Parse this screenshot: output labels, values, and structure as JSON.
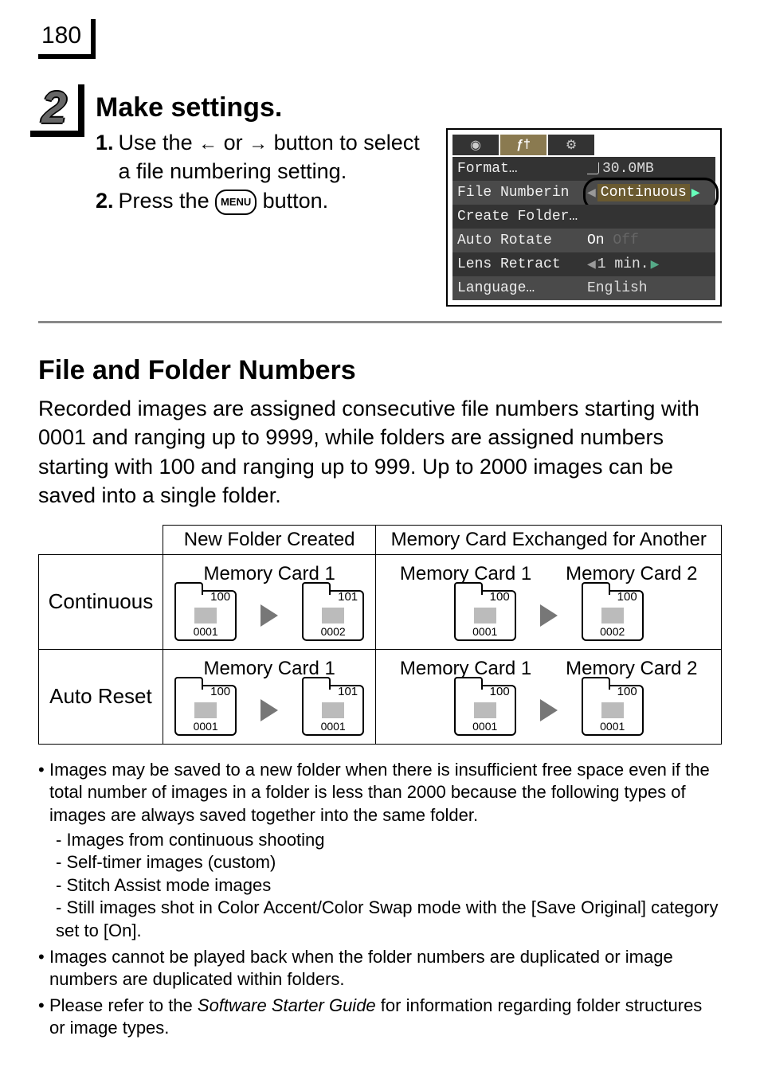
{
  "page_number": "180",
  "step": {
    "number": "2",
    "title": "Make settings.",
    "sub1_num": "1.",
    "sub1_a": "Use the ",
    "sub1_b": " or ",
    "sub1_c": " button to select a file numbering setting.",
    "sub2_num": "2.",
    "sub2_a": "Press the ",
    "sub2_b": " button.",
    "menu_label": "MENU"
  },
  "lcd": {
    "row1_label": "Format…",
    "row1_value": "30.0MB",
    "row2_label": "File Numberin",
    "row2_value": "Continuous",
    "row3_label": "Create Folder…",
    "row4_label": "Auto Rotate",
    "row4_value_on": "On",
    "row4_value_off": "Off",
    "row5_label": "Lens Retract",
    "row5_value": "1 min.",
    "row6_label": "Language…",
    "row6_value": "English"
  },
  "section_title": "File and Folder Numbers",
  "section_body": "Recorded images are assigned consecutive file numbers starting with 0001 and ranging up to 9999, while folders are assigned numbers starting with 100 and ranging up to 999. Up to 2000 images can be saved into a single folder.",
  "table": {
    "head_col1": "New Folder Created",
    "head_col2": "Memory Card Exchanged for Another",
    "row1_label": "Continuous",
    "row2_label": "Auto Reset",
    "mc1": "Memory Card 1",
    "mc2": "Memory Card 2",
    "f100": "100",
    "f101": "101",
    "n0001": "0001",
    "n0002": "0002"
  },
  "notes": {
    "n1": "Images may be saved to a new folder when there is insufficient free space even if the total number of images in a folder is less than 2000 because the following types of images are always saved together into the same folder.",
    "n1a": "Images from continuous shooting",
    "n1b": "Self-timer images (custom)",
    "n1c": "Stitch Assist mode images",
    "n1d": "Still images shot in Color Accent/Color Swap mode with the [Save Original] category set to [On].",
    "n2": "Images cannot be played back when the folder numbers are duplicated or image numbers are duplicated within folders.",
    "n3a": "Please refer to the ",
    "n3i": "Software Starter Guide",
    "n3b": " for information regarding folder structures or image types."
  }
}
